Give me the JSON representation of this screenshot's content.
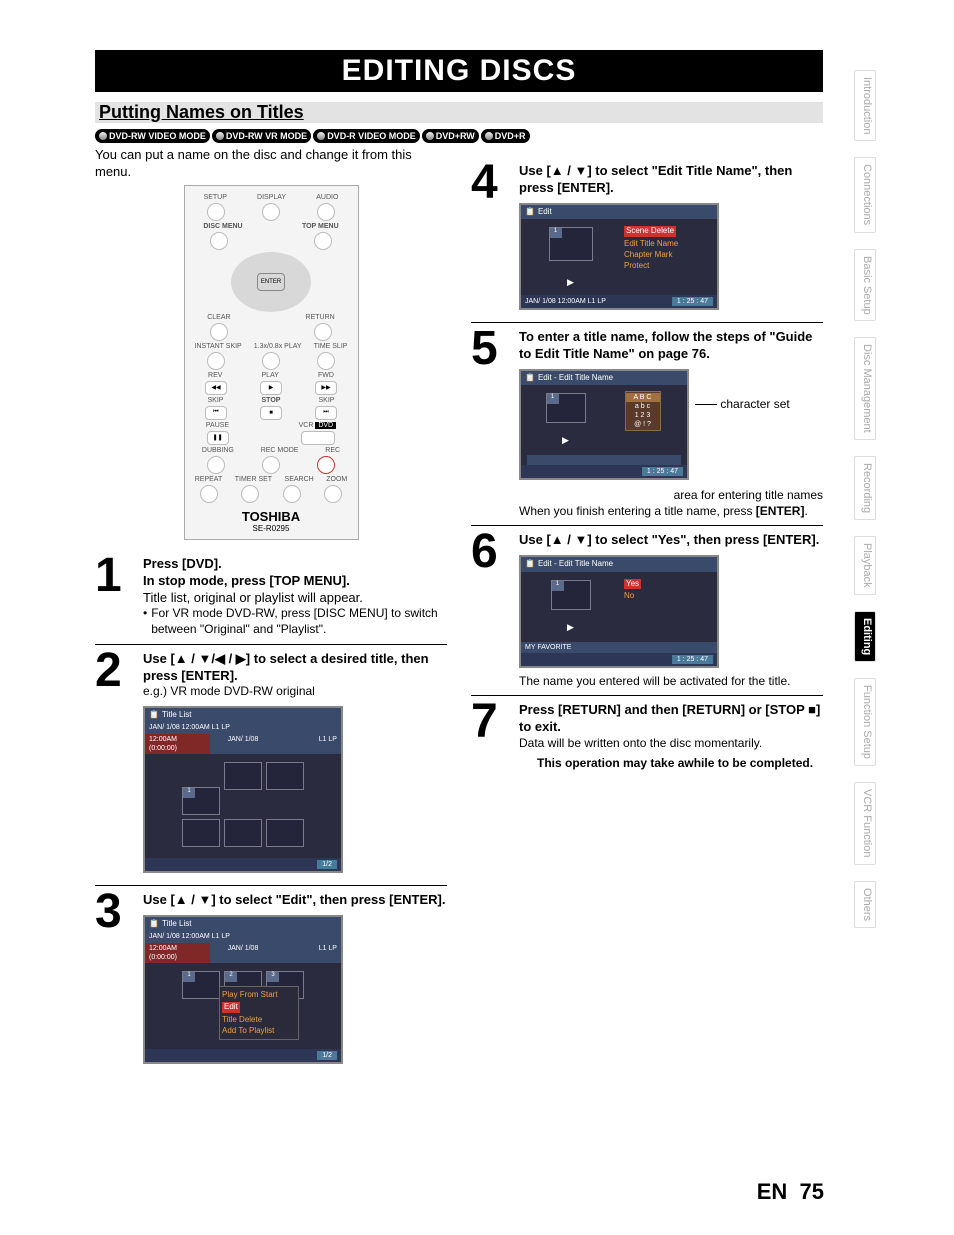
{
  "title": "EDITING DISCS",
  "section": "Putting Names on Titles",
  "dvd_formats": [
    "DVD-RW VIDEO MODE",
    "DVD-RW VR MODE",
    "DVD-R VIDEO MODE",
    "DVD+RW",
    "DVD+R"
  ],
  "intro": "You can put a name on the disc and change it from this menu.",
  "remote": {
    "labels": {
      "setup": "SETUP",
      "display": "DISPLAY",
      "audio": "AUDIO",
      "disc_menu": "DISC MENU",
      "top_menu": "TOP MENU",
      "enter": "ENTER",
      "clear": "CLEAR",
      "return": "RETURN",
      "instant_skip": "INSTANT SKIP",
      "play_1_3": "1.3x/0.8x PLAY",
      "time_slip": "TIME SLIP",
      "rev": "REV",
      "play": "PLAY",
      "fwd": "FWD",
      "skip_l": "SKIP",
      "stop": "STOP",
      "skip_r": "SKIP",
      "pause": "PAUSE",
      "vcr": "VCR",
      "dvd": "DVD",
      "dubbing": "DUBBING",
      "rec_mode": "REC MODE",
      "rec": "REC",
      "repeat": "REPEAT",
      "timer_set": "TIMER SET",
      "search": "SEARCH",
      "zoom": "ZOOM",
      "brand": "TOSHIBA",
      "model": "SE-R0295"
    }
  },
  "steps_left": [
    {
      "num": "1",
      "bold_lines": [
        "Press [DVD].",
        "In stop mode, press [TOP MENU]."
      ],
      "text": "Title list, original or playlist will appear.",
      "bullets": [
        "For VR mode DVD-RW, press [DISC MENU] to switch between \"Original\" and \"Playlist\"."
      ]
    },
    {
      "num": "2",
      "bold_lines": [
        "Use [▲ / ▼/◀ / ▶] to select a desired title, then press [ENTER]."
      ],
      "text": "e.g.) VR mode DVD-RW original",
      "screenshot": {
        "header": "Title List",
        "status_left": "JAN/ 1/08 12:00AM  L1   LP",
        "status_row2_left": "12:00AM (0:00:00)",
        "status_row2_mid": "JAN/ 1/08",
        "status_row2_right": "L1   LP",
        "page": "1/2"
      }
    },
    {
      "num": "3",
      "bold_lines": [
        "Use [▲ / ▼] to select \"Edit\", then press [ENTER]."
      ],
      "screenshot": {
        "header": "Title List",
        "status_left": "JAN/ 1/08 12:00AM  L1   LP",
        "menu": [
          "Play From Start",
          "Edit",
          "Title Delete",
          "Add To Playlist"
        ],
        "page": "1/2"
      }
    }
  ],
  "steps_right": [
    {
      "num": "4",
      "bold_lines": [
        "Use [▲ / ▼] to select \"Edit Title Name\", then press [ENTER]."
      ],
      "screenshot": {
        "header": "Edit",
        "menu": [
          "Scene Delete",
          "Edit Title Name",
          "Chapter Mark",
          "Protect"
        ],
        "status_left": "JAN/ 1/08 12:00AM L1   LP",
        "time": "1 : 25 : 47"
      }
    },
    {
      "num": "5",
      "bold_lines": [
        "To enter a title name, follow the steps of \"Guide to Edit Title Name\" on page 76."
      ],
      "screenshot": {
        "header": "Edit - Edit Title Name",
        "charset": [
          "A B C",
          "a b c",
          "1 2 3",
          "@ ! ?"
        ],
        "time": "1 : 25 : 47"
      },
      "annot_right": "character set",
      "annot_below": "area for entering title names",
      "after_text": "When you finish entering a title name, press ",
      "after_bold": "[ENTER]"
    },
    {
      "num": "6",
      "bold_lines": [
        "Use [▲ / ▼] to select \"Yes\", then press [ENTER]."
      ],
      "screenshot": {
        "header": "Edit - Edit Title Name",
        "menu": [
          "Yes",
          "No"
        ],
        "myfav": "MY FAVORITE",
        "time": "1 : 25 : 47"
      },
      "after_text": "The name you entered will be activated for the title."
    },
    {
      "num": "7",
      "bold_lines": [
        "Press [RETURN] and then [RETURN] or [STOP ■] to exit."
      ],
      "text": "Data will be written onto the disc momentarily.",
      "note": "This operation may take awhile to be completed."
    }
  ],
  "page_number_lang": "EN",
  "page_number": "75",
  "tabs": [
    "Introduction",
    "Connections",
    "Basic Setup",
    "Disc Management",
    "Recording",
    "Playback",
    "Editing",
    "Function Setup",
    "VCR Function",
    "Others"
  ],
  "active_tab": "Editing"
}
